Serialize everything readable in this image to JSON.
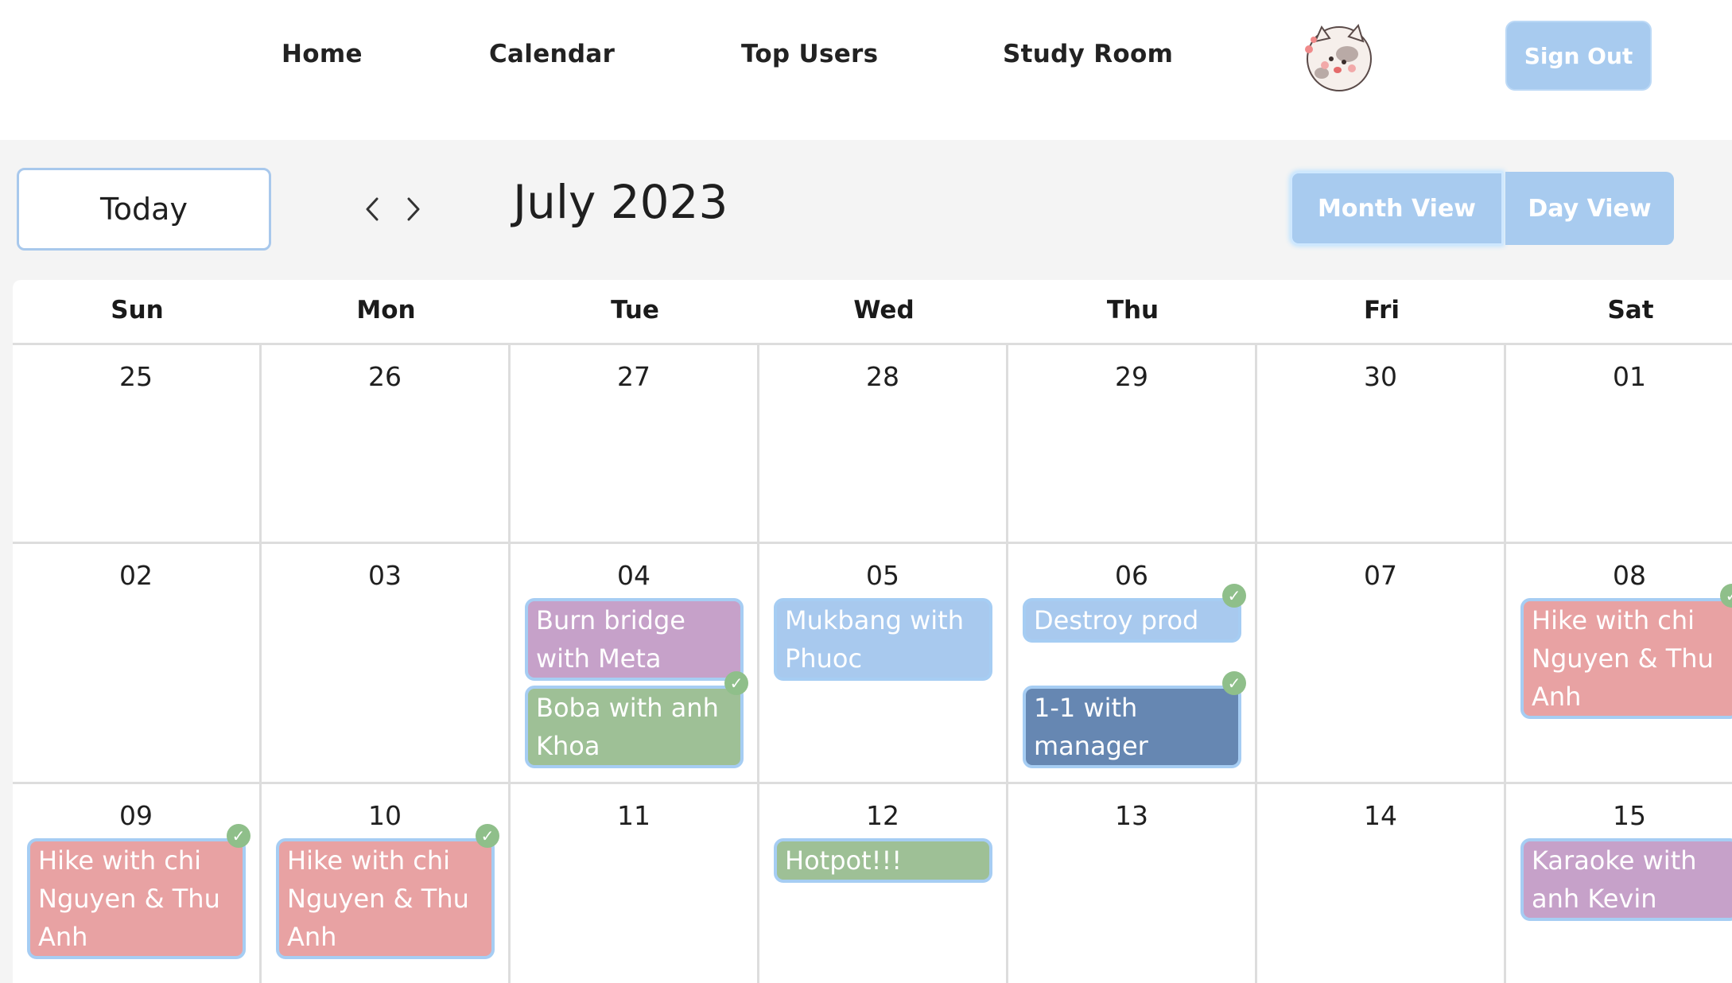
{
  "nav": {
    "links": [
      "Home",
      "Calendar",
      "Top Users",
      "Study Room"
    ],
    "sign_out": "Sign Out"
  },
  "toolbar": {
    "today": "Today",
    "month_title": "July 2023",
    "month_view": "Month View",
    "day_view": "Day View"
  },
  "days_of_week": [
    "Sun",
    "Mon",
    "Tue",
    "Wed",
    "Thu",
    "Fri",
    "Sat"
  ],
  "weeks": [
    [
      "25",
      "26",
      "27",
      "28",
      "29",
      "30",
      "01"
    ],
    [
      "02",
      "03",
      "04",
      "05",
      "06",
      "07",
      "08"
    ],
    [
      "09",
      "10",
      "11",
      "12",
      "13",
      "14",
      "15"
    ]
  ],
  "events": [
    {
      "week": 1,
      "day": 2,
      "slot": 0,
      "lines": 2,
      "title": "Burn bridge with Meta",
      "color": "#c6a1c9",
      "completed": false
    },
    {
      "week": 1,
      "day": 2,
      "slot": 1,
      "lines": 2,
      "title": "Boba with anh Khoa",
      "color": "#9ec096",
      "completed": true
    },
    {
      "week": 1,
      "day": 3,
      "slot": 0,
      "lines": 2,
      "title": "Mukbang with Phuoc",
      "color": "#a8c9ee",
      "completed": false
    },
    {
      "week": 1,
      "day": 4,
      "slot": 0,
      "lines": 1,
      "title": "Destroy prod",
      "color": "#a8c9ee",
      "completed": true
    },
    {
      "week": 1,
      "day": 4,
      "slot": 1,
      "lines": 2,
      "title": "1-1 with manager",
      "color": "#6687b2",
      "completed": true
    },
    {
      "week": 1,
      "day": 6,
      "slot": 0,
      "lines": 3,
      "title": "Hike with chi Nguyen & Thu Anh",
      "color": "#e8a2a3",
      "completed": true
    },
    {
      "week": 2,
      "day": 0,
      "slot": 0,
      "lines": 3,
      "title": "Hike with chi Nguyen & Thu Anh",
      "color": "#e8a2a3",
      "completed": true
    },
    {
      "week": 2,
      "day": 1,
      "slot": 0,
      "lines": 3,
      "title": "Hike with chi Nguyen & Thu Anh",
      "color": "#e8a2a3",
      "completed": true
    },
    {
      "week": 2,
      "day": 3,
      "slot": 0,
      "lines": 1,
      "title": "Hotpot!!!",
      "color": "#9ec096",
      "completed": false
    },
    {
      "week": 2,
      "day": 6,
      "slot": 0,
      "lines": 2,
      "title": "Karaoke with anh Kevin",
      "color": "#c6a1c9",
      "completed": false
    }
  ],
  "icons": {
    "prev": "chevron-left-icon",
    "next": "chevron-right-icon",
    "avatar": "cat-avatar",
    "check": "check-icon"
  }
}
